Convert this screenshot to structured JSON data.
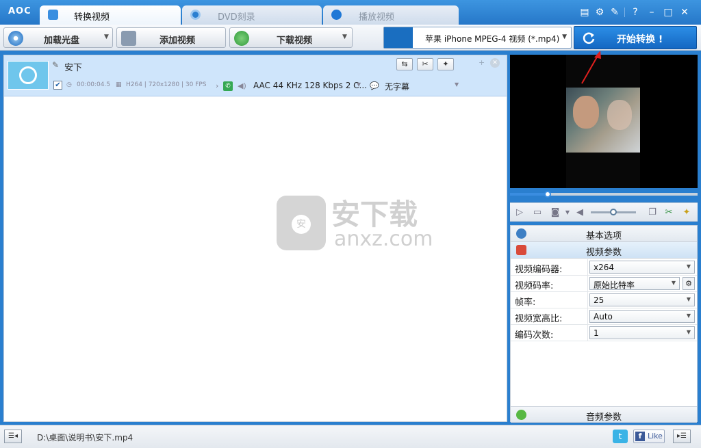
{
  "titlebar": {
    "logo": "AOC",
    "tabs": [
      {
        "label": "转换视频",
        "active": true
      },
      {
        "label": "DVD刻录",
        "active": false
      },
      {
        "label": "播放视频",
        "active": false
      }
    ]
  },
  "toolbar": {
    "load_disc": "加载光盘",
    "add_video": "添加视频",
    "download_video": "下载视频",
    "profile": "苹果 iPhone MPEG-4 视频 (*.mp4)",
    "start": "开始转换 !"
  },
  "file": {
    "name": "安下",
    "duration": "00:00:04.5",
    "video_info": "H264 | 720x1280 | 30 FPS",
    "audio": "AAC 44 KHz 128 Kbps 2 C...",
    "subtitle": "无字幕"
  },
  "watermark": {
    "title": "安下载",
    "sub": "anxz.com"
  },
  "playback": {
    "progress": 0.2,
    "volume": 0.5
  },
  "settings": {
    "basic_header": "基本选项",
    "video_header": "视频参数",
    "audio_header": "音频参数",
    "rows": [
      {
        "key": "视频编码器:",
        "value": "x264"
      },
      {
        "key": "视频码率:",
        "value": "原始比特率"
      },
      {
        "key": "帧率:",
        "value": "25"
      },
      {
        "key": "视频宽高比:",
        "value": "Auto"
      },
      {
        "key": "编码次数:",
        "value": "1"
      }
    ]
  },
  "status": {
    "path": "D:\\桌面\\说明书\\安下.mp4",
    "like": "Like"
  },
  "colors": {
    "accent": "#2677c8",
    "selected_row": "#cfe5fb",
    "start_button": "#1a76d2"
  }
}
